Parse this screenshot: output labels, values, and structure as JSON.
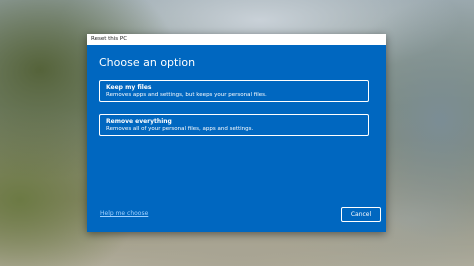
{
  "window": {
    "title": "Reset this PC"
  },
  "dialog": {
    "heading": "Choose an option",
    "options": [
      {
        "title": "Keep my files",
        "description": "Removes apps and settings, but keeps your personal files."
      },
      {
        "title": "Remove everything",
        "description": "Removes all of your personal files, apps and settings."
      }
    ],
    "help_link": "Help me choose",
    "cancel_label": "Cancel"
  },
  "colors": {
    "dialog_background": "#0067c0",
    "titlebar_background": "#ffffff",
    "link": "#9fd0ff"
  }
}
